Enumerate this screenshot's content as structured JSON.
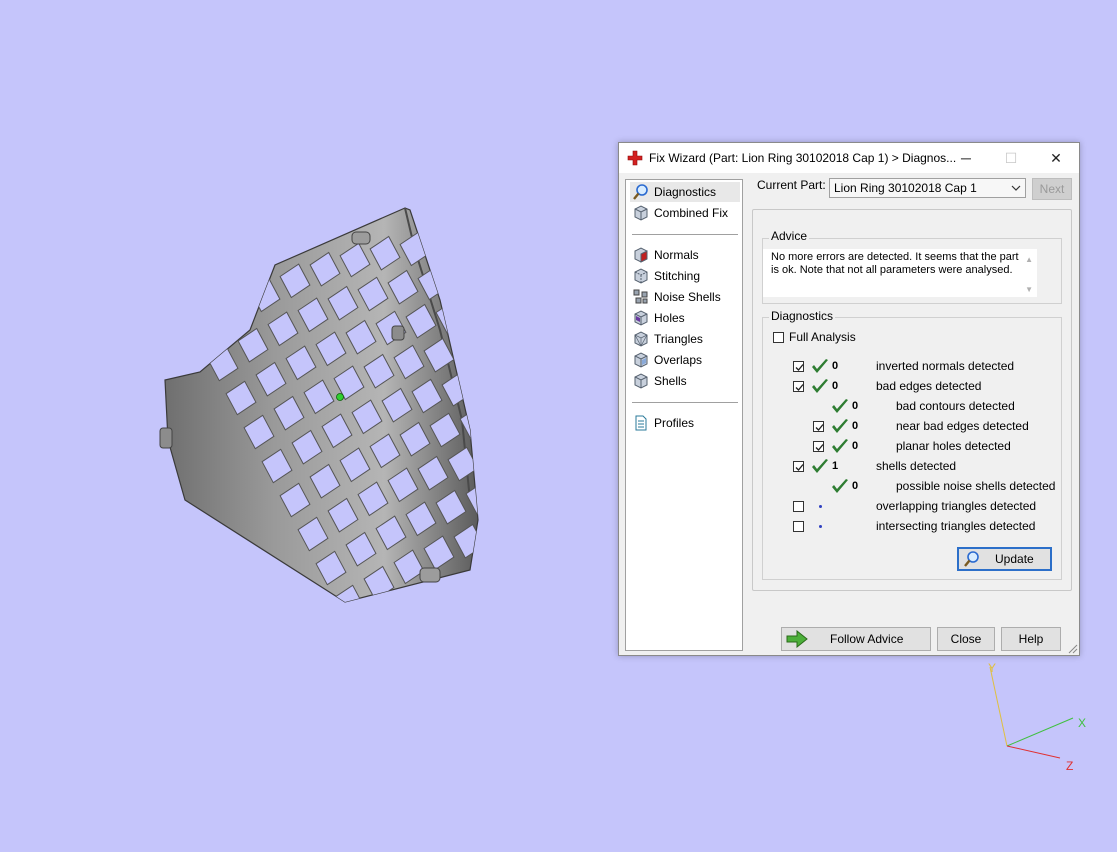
{
  "dialog": {
    "title": "Fix Wizard (Part: Lion Ring 30102018 Cap 1) > Diagnos...",
    "window_buttons": {
      "minimize": "─",
      "maximize": "☐",
      "close": "✕"
    }
  },
  "sidebar": {
    "top_items": [
      {
        "label": "Diagnostics",
        "icon": "magnifier-icon"
      },
      {
        "label": "Combined Fix",
        "icon": "cube-icon"
      }
    ],
    "fix_items": [
      {
        "label": "Normals",
        "icon": "normals-cube-icon"
      },
      {
        "label": "Stitching",
        "icon": "stitching-cube-icon"
      },
      {
        "label": "Noise Shells",
        "icon": "noise-shells-icon"
      },
      {
        "label": "Holes",
        "icon": "holes-cube-icon"
      },
      {
        "label": "Triangles",
        "icon": "triangles-cube-icon"
      },
      {
        "label": "Overlaps",
        "icon": "overlaps-cube-icon"
      },
      {
        "label": "Shells",
        "icon": "shells-cube-icon"
      }
    ],
    "bottom_items": [
      {
        "label": "Profiles",
        "icon": "document-icon"
      }
    ]
  },
  "current_part": {
    "label": "Current Part:",
    "value": "Lion Ring 30102018 Cap 1",
    "next_label": "Next"
  },
  "advice": {
    "title": "Advice",
    "text": "No more errors are detected. It seems that the part is ok. Note that not all parameters were analysed."
  },
  "diagnostics": {
    "title": "Diagnostics",
    "full_analysis_label": "Full Analysis",
    "full_analysis_checked": false,
    "rows": [
      {
        "label": "inverted normals detected",
        "count": "0",
        "checked": true,
        "status": "ok",
        "indent": 0
      },
      {
        "label": "bad edges detected",
        "count": "0",
        "checked": true,
        "status": "ok",
        "indent": 0
      },
      {
        "label": "bad contours detected",
        "count": "0",
        "checked": null,
        "status": "ok",
        "indent": 1
      },
      {
        "label": "near bad edges detected",
        "count": "0",
        "checked": true,
        "status": "ok",
        "indent": 1
      },
      {
        "label": "planar holes detected",
        "count": "0",
        "checked": true,
        "status": "ok",
        "indent": 1
      },
      {
        "label": "shells detected",
        "count": "1",
        "checked": true,
        "status": "ok",
        "indent": 0
      },
      {
        "label": "possible noise shells detected",
        "count": "0",
        "checked": null,
        "status": "ok",
        "indent": 1
      },
      {
        "label": "overlapping triangles detected",
        "count": "",
        "checked": false,
        "status": "pending",
        "indent": 0
      },
      {
        "label": "intersecting triangles detected",
        "count": "",
        "checked": false,
        "status": "pending",
        "indent": 0
      }
    ],
    "update_label": "Update"
  },
  "footer": {
    "follow_advice_label": "Follow Advice",
    "close_label": "Close",
    "help_label": "Help"
  },
  "axes": {
    "x": "X",
    "y": "Y",
    "z": "Z"
  },
  "colors": {
    "background": "#c5c5fb",
    "tick_green": "#2e7d32",
    "title_icon_red": "#d32020",
    "axis_x": "#40c040",
    "axis_y": "#e0c040",
    "axis_z": "#e03030"
  }
}
